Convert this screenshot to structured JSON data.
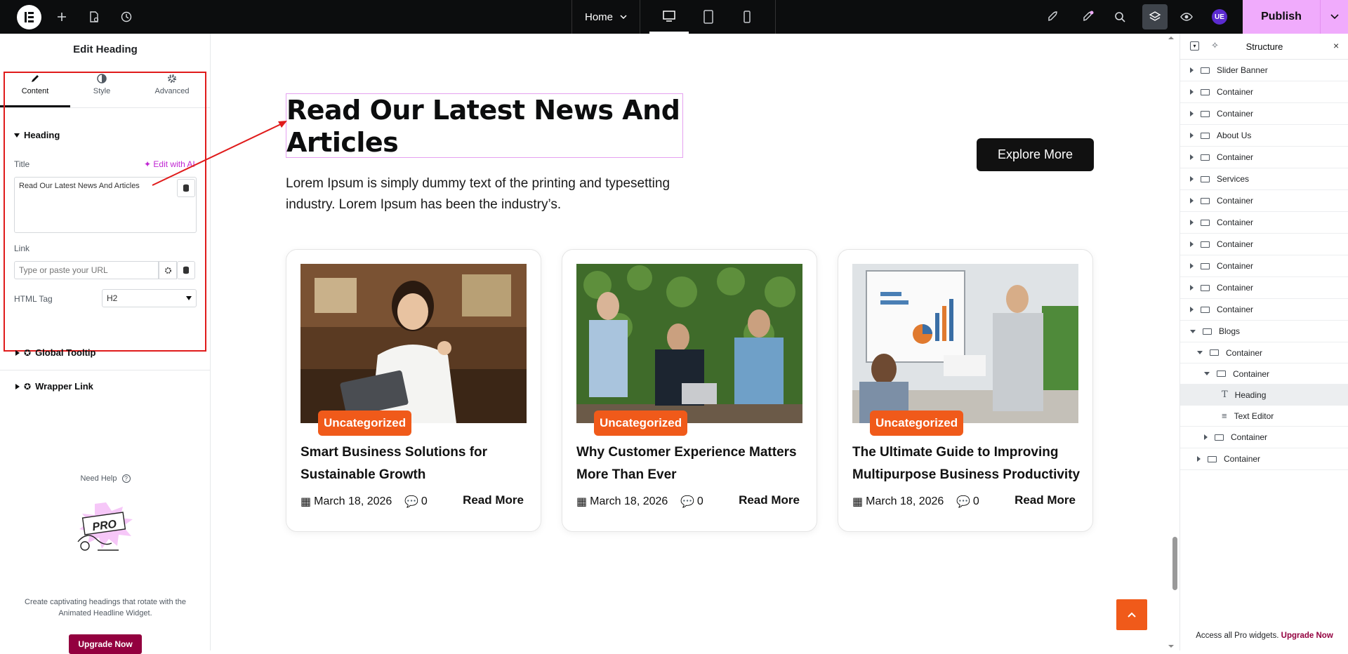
{
  "topbar": {
    "page_name": "Home",
    "avatar_initials": "UE",
    "publish_label": "Publish"
  },
  "left_panel": {
    "title": "Edit Heading",
    "tabs": [
      {
        "label": "Content",
        "icon": "pencil-icon"
      },
      {
        "label": "Style",
        "icon": "contrast-icon"
      },
      {
        "label": "Advanced",
        "icon": "gear-icon"
      }
    ],
    "section_heading": "Heading",
    "title_label": "Title",
    "edit_ai_label": "Edit with AI",
    "title_value": "Read Our Latest News And Articles",
    "link_label": "Link",
    "link_placeholder": "Type or paste your URL",
    "html_tag_label": "HTML Tag",
    "html_tag_value": "H2",
    "global_tooltip": "Global Tooltip",
    "wrapper_link": "Wrapper Link",
    "need_help": "Need Help",
    "promo_text": "Create captivating headings that rotate with the Animated Headline Widget.",
    "upgrade_label": "Upgrade Now",
    "pro_badge": "PRO"
  },
  "canvas": {
    "heading": "Read Our Latest News And Articles",
    "subtext": "Lorem Ipsum is simply dummy text of the printing and typesetting industry. Lorem Ipsum has been the industry’s.",
    "explore_label": "Explore More",
    "cards": [
      {
        "badge": "Uncategorized",
        "title": "Smart Business Solutions for Sustainable Growth",
        "date": "March 18, 2026",
        "comments": "0",
        "read_more": "Read More"
      },
      {
        "badge": "Uncategorized",
        "title": "Why Customer Experience Matters More Than Ever",
        "date": "March 18, 2026",
        "comments": "0",
        "read_more": "Read More"
      },
      {
        "badge": "Uncategorized",
        "title": "The Ultimate Guide to Improving Multipurpose Business Productivity",
        "date": "March 18, 2026",
        "comments": "0",
        "read_more": "Read More"
      }
    ]
  },
  "structure": {
    "title": "Structure",
    "items": [
      {
        "label": "Slider Banner"
      },
      {
        "label": "Container"
      },
      {
        "label": "Container"
      },
      {
        "label": "About Us"
      },
      {
        "label": "Container"
      },
      {
        "label": "Services"
      },
      {
        "label": "Container"
      },
      {
        "label": "Container"
      },
      {
        "label": "Container"
      },
      {
        "label": "Container"
      },
      {
        "label": "Container"
      },
      {
        "label": "Container"
      },
      {
        "label": "Blogs"
      },
      {
        "label": "Container"
      },
      {
        "label": "Container"
      },
      {
        "label": "Heading"
      },
      {
        "label": "Text Editor"
      },
      {
        "label": "Container"
      },
      {
        "label": "Container"
      }
    ],
    "footer_text": "Access all Pro widgets.",
    "footer_link": "Upgrade Now"
  },
  "colors": {
    "accent_orange": "#f05a1a",
    "publish_pink": "#f0abfc",
    "upgrade_maroon": "#93003f",
    "highlight_red": "#e01b1b"
  }
}
